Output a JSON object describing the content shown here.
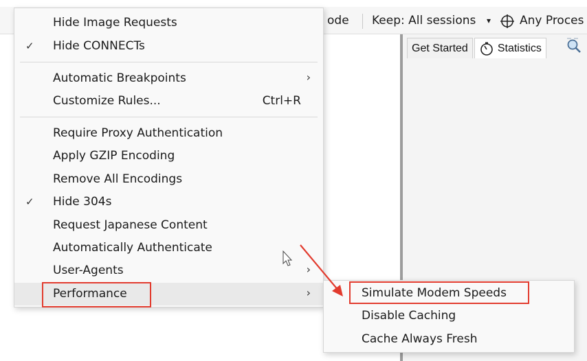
{
  "toolbar": {
    "stream_partial": "ode",
    "keep_label": "Keep: All sessions",
    "keep_dropdown_glyph": "▾",
    "process_label": "Any Proces"
  },
  "tabs": [
    {
      "label": "Get Started"
    },
    {
      "label": "Statistics"
    }
  ],
  "menu": {
    "check_glyph": "✓",
    "arrow_glyph": "›",
    "items": [
      {
        "label": "Hide Image Requests",
        "checked": false
      },
      {
        "label": "Hide CONNECTs",
        "checked": true
      },
      {
        "label": "Automatic Breakpoints",
        "submenu": true
      },
      {
        "label": "Customize Rules...",
        "shortcut": "Ctrl+R"
      },
      {
        "label": "Require Proxy Authentication"
      },
      {
        "label": "Apply GZIP Encoding"
      },
      {
        "label": "Remove All Encodings"
      },
      {
        "label": "Hide 304s",
        "checked": true
      },
      {
        "label": "Request Japanese Content"
      },
      {
        "label": "Automatically Authenticate"
      },
      {
        "label": "User-Agents",
        "submenu": true
      },
      {
        "label": "Performance",
        "submenu": true,
        "highlighted": true
      }
    ]
  },
  "submenu": {
    "items": [
      {
        "label": "Simulate Modem Speeds"
      },
      {
        "label": "Disable Caching"
      },
      {
        "label": "Cache Always Fresh"
      }
    ]
  },
  "colors": {
    "annotation_red": "#e23b2e",
    "menu_bg": "#f9f9f9",
    "highlight_bg": "#e9e9e9"
  }
}
